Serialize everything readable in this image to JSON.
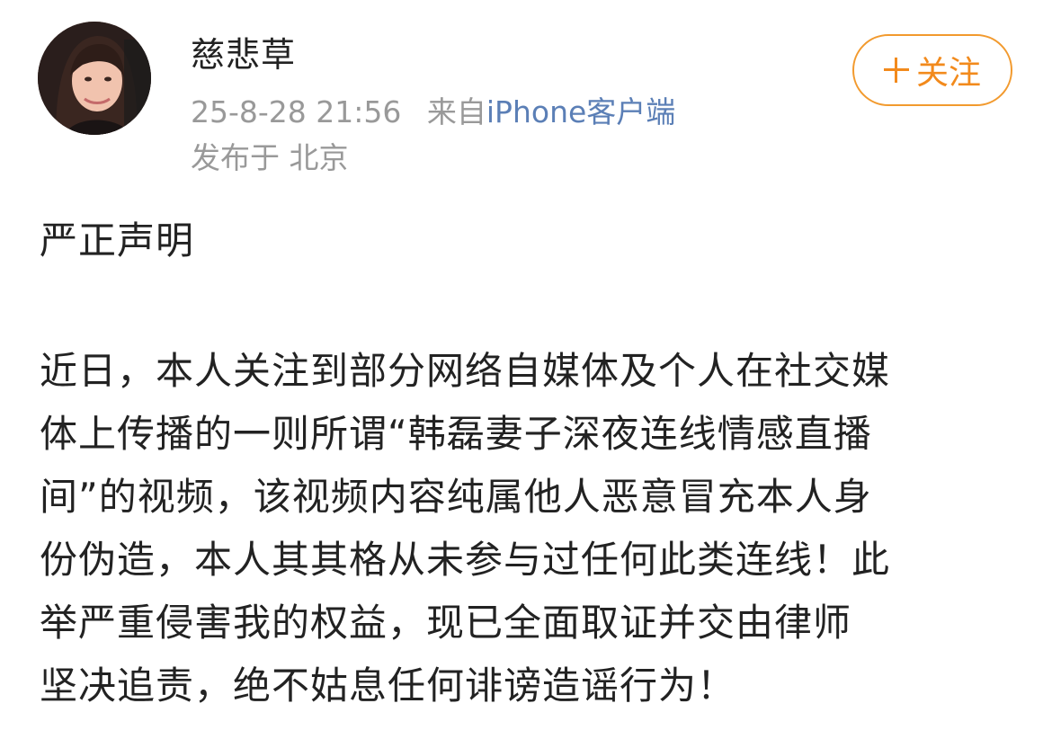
{
  "user": {
    "name": "慈悲草",
    "avatar_icon": "profile-photo-avatar"
  },
  "meta": {
    "timestamp": "25-8-28 21:56",
    "source_prefix": "来自",
    "source": "iPhone客户端",
    "location": "发布于 北京"
  },
  "follow": {
    "label": "关注",
    "icon": "plus-icon",
    "color": "#f28a1c"
  },
  "post": {
    "title": "严正声明",
    "lines": [
      "近日，本人关注到部分网络自媒体及个人在社交媒",
      "体上传播的一则所谓“韩磊妻子深夜连线情感直播",
      "间”的视频，该视频内容纯属他人恶意冒充本人身",
      "份伪造，本人其其格从未参与过任何此类连线！此",
      "举严重侵害我的权益，现已全面取证并交由律师",
      "坚决追责，绝不姑息任何诽谤造谣行为！"
    ]
  },
  "colors": {
    "text": "#222222",
    "muted": "#999999",
    "link": "#5b7fb6",
    "accent": "#f28a1c"
  }
}
